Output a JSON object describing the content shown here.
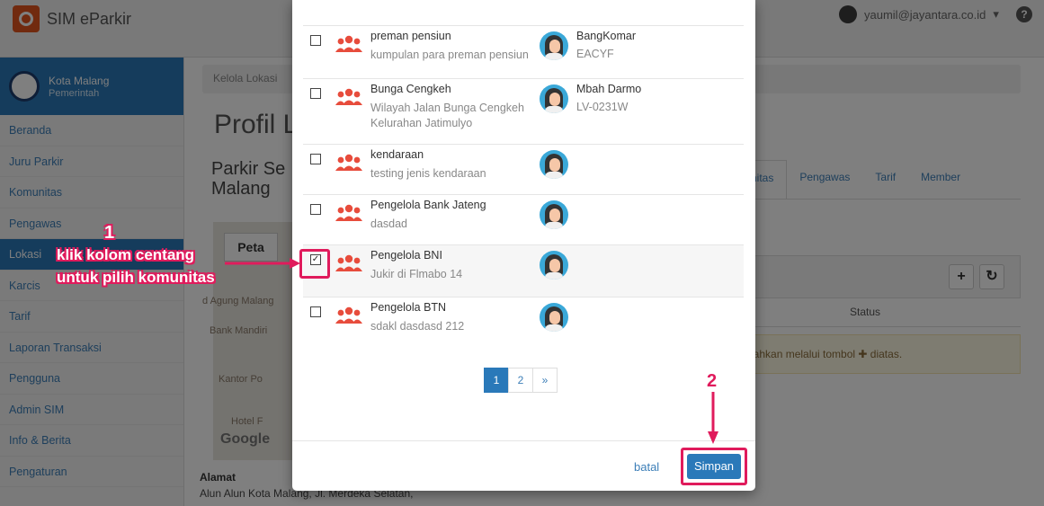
{
  "navbar": {
    "brand": "SIM eParkir",
    "user_email": "yaumil@jayantara.co.id",
    "user_caret": "▾",
    "help_glyph": "?"
  },
  "sidebar": {
    "org_name": "Kota Malang",
    "org_sub": "Pemerintah",
    "items": [
      {
        "label": "Beranda"
      },
      {
        "label": "Juru Parkir"
      },
      {
        "label": "Komunitas"
      },
      {
        "label": "Pengawas"
      },
      {
        "label": "Lokasi"
      },
      {
        "label": "Karcis"
      },
      {
        "label": "Tarif"
      },
      {
        "label": "Laporan Transaksi"
      },
      {
        "label": "Pengguna"
      },
      {
        "label": "Admin SIM"
      },
      {
        "label": "Info & Berita"
      },
      {
        "label": "Pengaturan"
      }
    ]
  },
  "main": {
    "breadcrumb": "Kelola Lokasi",
    "title": "Profil L",
    "subtitle": "Parkir Se Malang",
    "tabs": [
      "nitas",
      "Pengawas",
      "Tarif",
      "Member"
    ],
    "map_tab": "Peta",
    "map_labels": [
      "d Agung Malang",
      "Bank Mandiri",
      "Kantor Po",
      "Hotel F"
    ],
    "google": "Google",
    "status_header": "Status",
    "alert_text": "bahkan melalui tombol ✚ diatas.",
    "plus_glyph": "+",
    "refresh_glyph": "↻",
    "alamat_label": "Alamat",
    "alamat_text": "Alun Alun Kota Malang, Jl. Merdeka Selatan,"
  },
  "modal": {
    "rows": [
      {
        "name": "preman pensiun",
        "desc": "kumpulan para preman pensiun",
        "person_name": "BangKomar",
        "person_code": "EACYF",
        "checked": false
      },
      {
        "name": "Bunga Cengkeh",
        "desc": "Wilayah Jalan Bunga Cengkeh Kelurahan Jatimulyo",
        "person_name": "Mbah Darmo",
        "person_code": "LV-0231W",
        "checked": false
      },
      {
        "name": "kendaraan",
        "desc": "testing jenis kendaraan",
        "person_name": "",
        "person_code": "",
        "checked": false
      },
      {
        "name": "Pengelola Bank Jateng",
        "desc": "dasdad",
        "person_name": "",
        "person_code": "",
        "checked": false
      },
      {
        "name": "Pengelola BNI",
        "desc": "Jukir di Flmabo 14",
        "person_name": "",
        "person_code": "",
        "checked": true
      },
      {
        "name": "Pengelola BTN",
        "desc": "sdakl dasdasd 212",
        "person_name": "",
        "person_code": "",
        "checked": false
      }
    ],
    "pagination": [
      "1",
      "2",
      "»"
    ],
    "active_page": "1",
    "cancel_label": "batal",
    "save_label": "Simpan"
  },
  "annotations": {
    "step1_number": "1",
    "step1_line1": "klik kolom centang",
    "step1_line2": "untuk pilih komunitas",
    "step2_number": "2"
  },
  "colors": {
    "accent": "#2a79b9",
    "annotation": "#e01b5c",
    "brand": "#e2541f",
    "group_icon": "#e74c3c"
  }
}
